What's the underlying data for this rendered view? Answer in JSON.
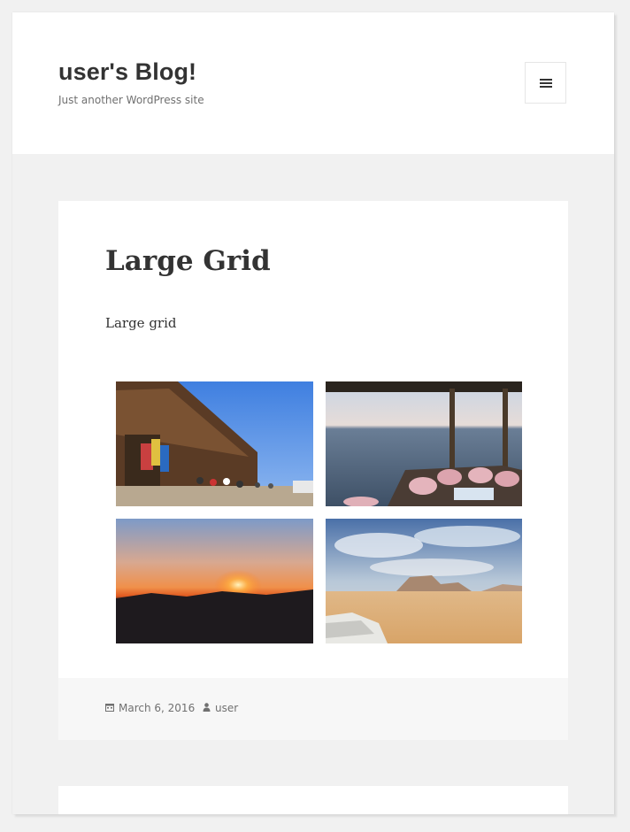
{
  "site": {
    "title": "user's Blog!",
    "description": "Just another WordPress site"
  },
  "header": {
    "menu_icon": "hamburger-menu-icon"
  },
  "post": {
    "title": "Large Grid",
    "content": "Large grid",
    "gallery": [
      {
        "name": "market-terrace-photo"
      },
      {
        "name": "sea-view-lounge-photo"
      },
      {
        "name": "mountain-sunset-photo"
      },
      {
        "name": "desert-landscape-photo"
      }
    ],
    "meta": {
      "date": "March 6, 2016",
      "date_icon": "calendar-icon",
      "author": "user",
      "author_icon": "person-icon"
    }
  },
  "colors": {
    "page_bg": "#f1f1f1",
    "card_bg": "#ffffff",
    "footer_bg": "#f7f7f7",
    "text": "#333333",
    "muted_text": "#707070"
  }
}
